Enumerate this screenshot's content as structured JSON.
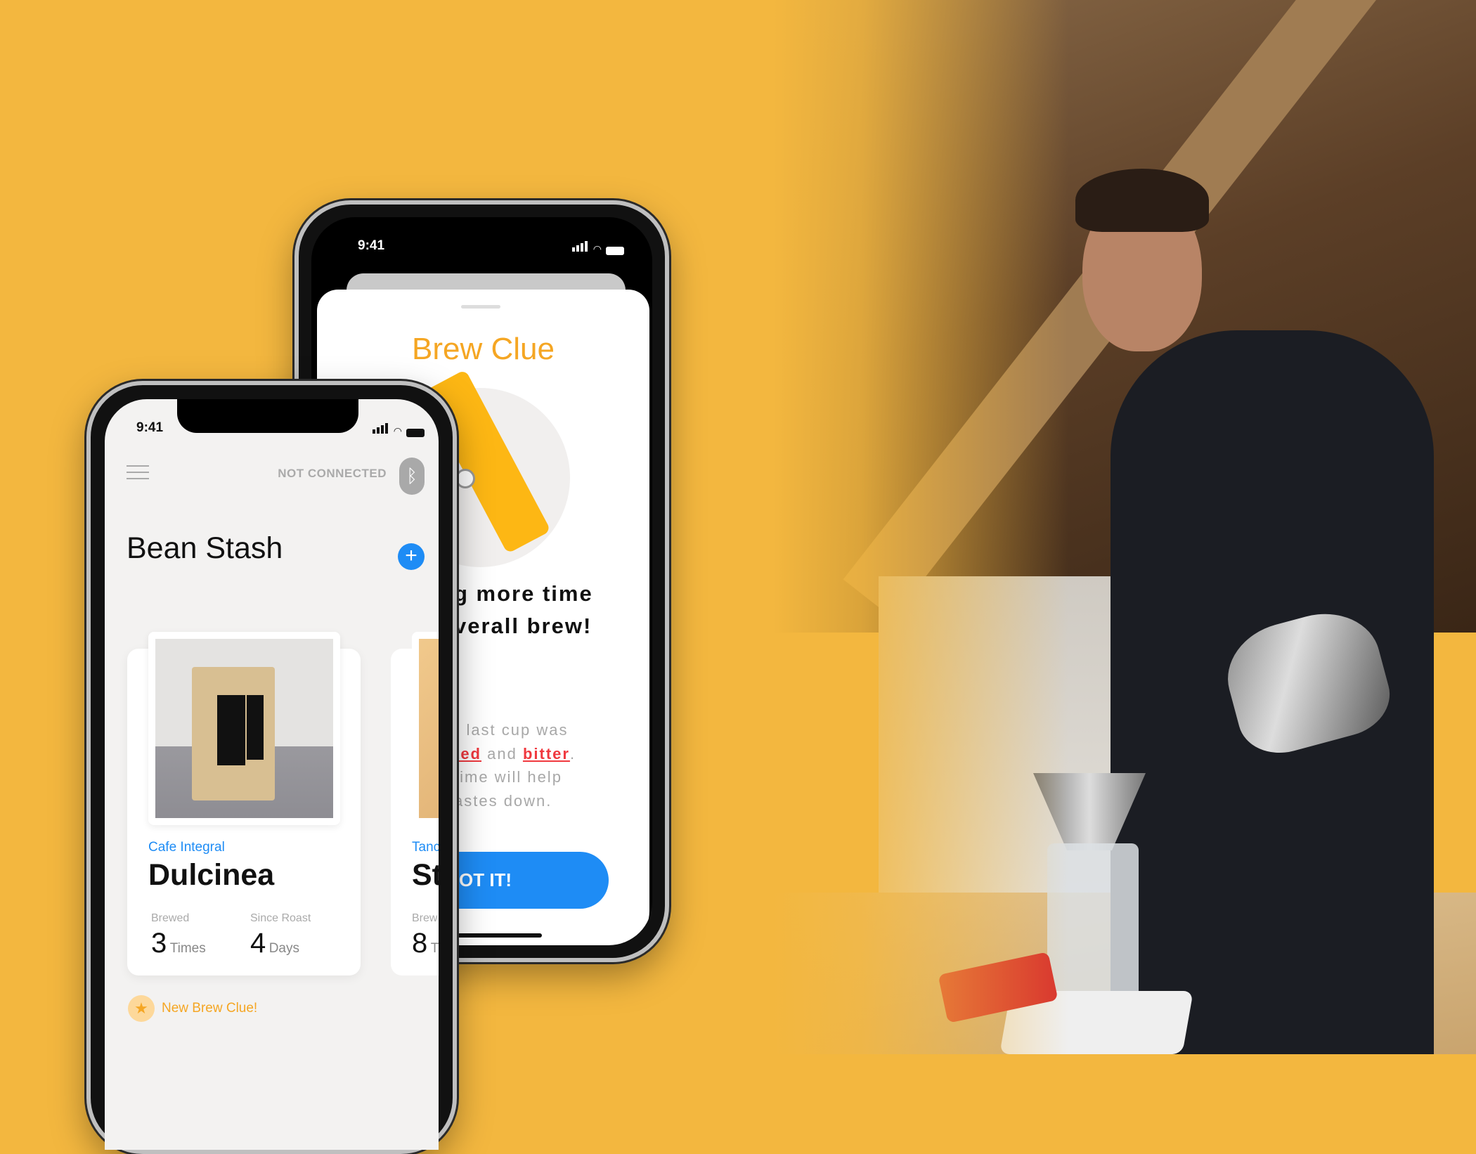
{
  "colors": {
    "background": "#F3B73F",
    "accent_orange": "#F5A623",
    "accent_blue": "#1E8CF5",
    "warning_red": "#F0383E"
  },
  "back_phone": {
    "status_time": "9:41",
    "modal": {
      "title": "Brew Clue",
      "headline_lines": [
        "g more time",
        "verall brew!"
      ],
      "body_lines": [
        {
          "text": "r last cup was"
        },
        {
          "parts": [
            {
              "text": "ted",
              "style": "red"
            },
            {
              "text": " and ",
              "style": "normal"
            },
            {
              "text": "bitter",
              "style": "red"
            },
            {
              "text": ".",
              "style": "normal"
            }
          ]
        },
        {
          "text": "time will help"
        },
        {
          "text": "astes down."
        }
      ],
      "button_label": "OT IT!"
    }
  },
  "front_phone": {
    "status_time": "9:41",
    "connection_status": "NOT CONNECTED",
    "page_title": "Bean Stash",
    "cards": [
      {
        "roaster": "Cafe Integral",
        "name": "Dulcinea",
        "stats": [
          {
            "label": "Brewed",
            "value": "3",
            "unit": "Times"
          },
          {
            "label": "Since Roast",
            "value": "4",
            "unit": "Days"
          }
        ]
      },
      {
        "roaster": "Tanc",
        "name": "St",
        "stats": [
          {
            "label": "Brew",
            "value": "8",
            "unit": "T"
          }
        ]
      }
    ],
    "notification": "New Brew Clue!"
  }
}
